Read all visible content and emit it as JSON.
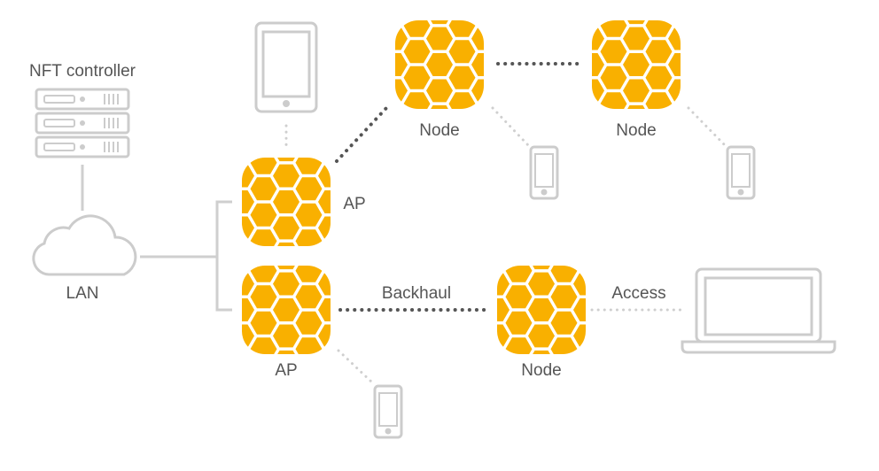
{
  "colors": {
    "node": "#F9B000",
    "line_light": "#cfcfcf",
    "dots_dark": "#555555",
    "text": "#555555",
    "device": "#cccccc"
  },
  "labels": {
    "controller": "NFT controller",
    "lan": "LAN",
    "ap_top": "AP",
    "ap_bottom": "AP",
    "node_top_left": "Node",
    "node_top_right": "Node",
    "node_bottom": "Node",
    "backhaul": "Backhaul",
    "access": "Access"
  },
  "icons": [
    "server-rack-icon",
    "cloud-icon",
    "tablet-icon",
    "phone-icon",
    "laptop-icon",
    "mesh-node-icon"
  ]
}
